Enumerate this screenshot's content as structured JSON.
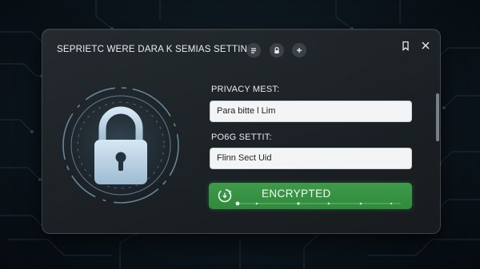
{
  "window": {
    "title": "SEPRIETC WERE DARA K SEMIAS SETTING",
    "header_icons": [
      "list-icon",
      "lock-icon",
      "plus-icon"
    ],
    "controls": [
      "bookmark-icon",
      "close-icon"
    ]
  },
  "form": {
    "privacy_label": "PRIVACY MEST:",
    "privacy_value": "Para bitte l Lim",
    "second_label": "PO6G SETTIT:",
    "second_value": "Flinn Sect Uid"
  },
  "status": {
    "text": "ENCRYPTED",
    "icon": "sync-icon",
    "color": "#3a9645"
  },
  "colors": {
    "accent_glow": "#7fb6d9",
    "lock_body": "#b9d3e6"
  }
}
